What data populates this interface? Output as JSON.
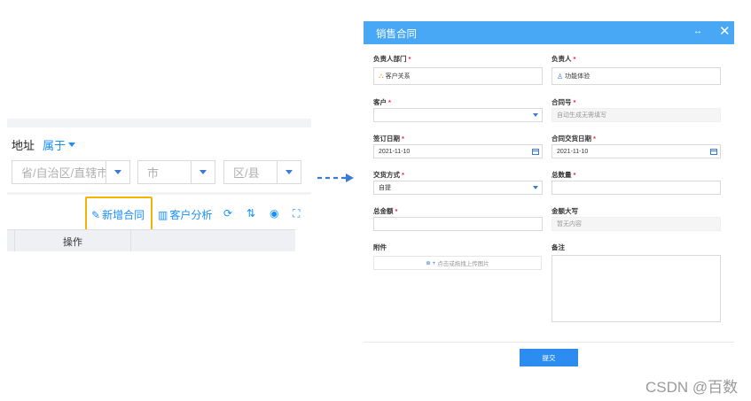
{
  "left_panel": {
    "field_label": "地址",
    "filter_label": "属于",
    "selects": [
      {
        "placeholder": "省/自治区/直辖市"
      },
      {
        "placeholder": "市"
      },
      {
        "placeholder": "区/县"
      }
    ],
    "toolbar": {
      "add_contract": "新增合同",
      "customer_analysis": "客户分析"
    },
    "table": {
      "col_op": "操作"
    }
  },
  "modal": {
    "title": "销售合同",
    "expand_glyph": "↔",
    "close_glyph": "✕",
    "fields": {
      "owner_dept": {
        "label": "负责人部门",
        "value": "客户关系"
      },
      "owner": {
        "label": "负责人",
        "value": "功能体验"
      },
      "customer": {
        "label": "客户",
        "value": ""
      },
      "contract_no": {
        "label": "合同号",
        "placeholder": "自动生成无需填写"
      },
      "sign_date": {
        "label": "签订日期",
        "value": "2021-11-10"
      },
      "delivery_date": {
        "label": "合同交货日期",
        "value": "2021-11-10"
      },
      "delivery_method": {
        "label": "交货方式",
        "value": "自提"
      },
      "total_qty": {
        "label": "总数量",
        "value": ""
      },
      "total_amount": {
        "label": "总金额",
        "value": ""
      },
      "amount_upper": {
        "label": "金额大写",
        "placeholder": "暂无内容"
      },
      "attachment": {
        "label": "附件",
        "upload_text": "点击或拖拽上传图片"
      },
      "remark": {
        "label": "备注",
        "value": ""
      }
    },
    "submit_label": "提交"
  },
  "watermark": "CSDN @百数",
  "colors": {
    "header": "#49a8f5",
    "highlight": "#f5b400",
    "primary": "#2d8cf0",
    "arrow": "#3a7bd5"
  }
}
